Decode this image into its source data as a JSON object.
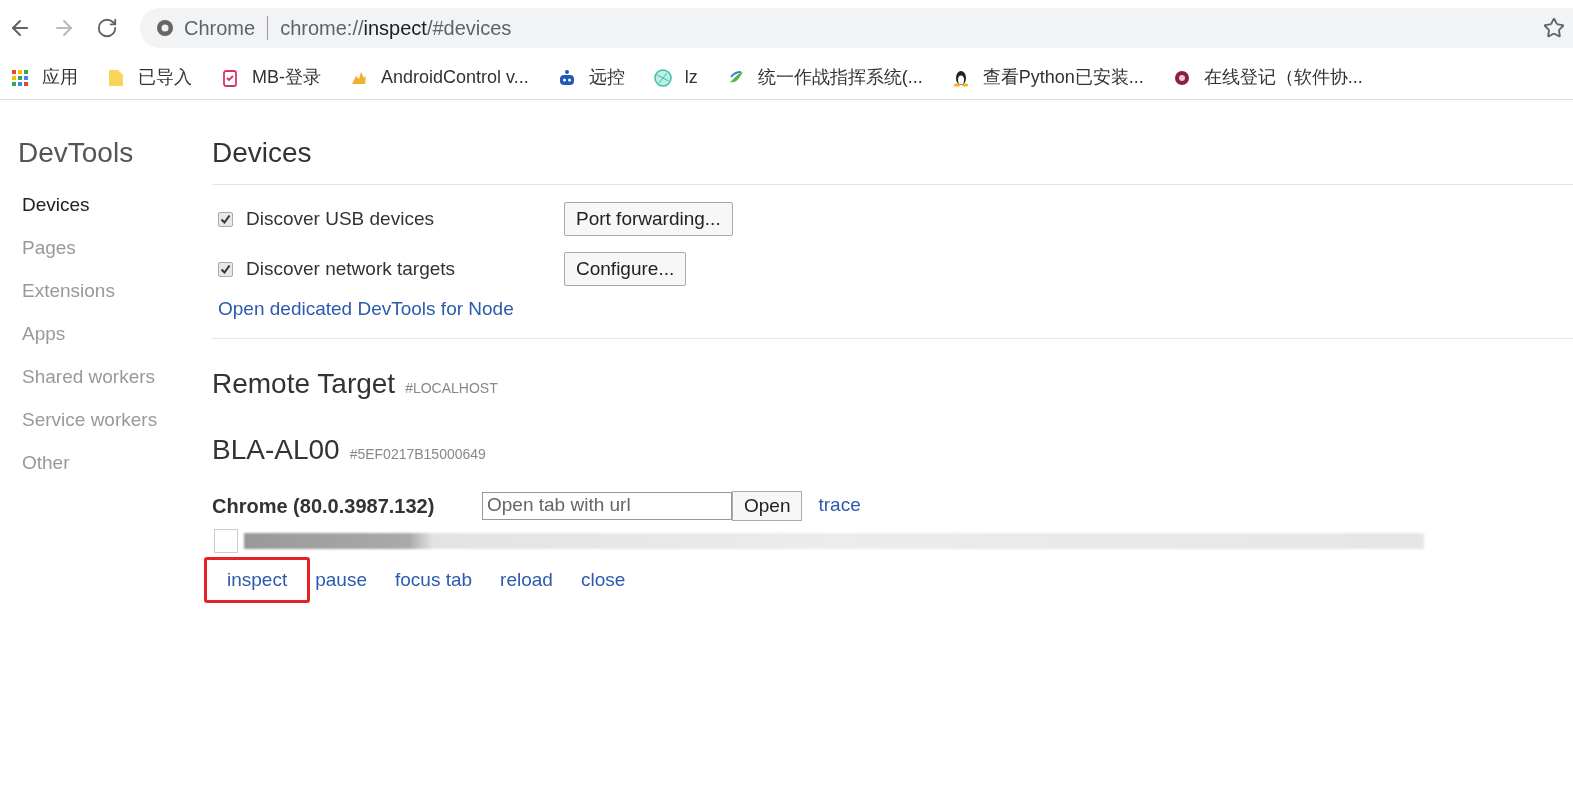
{
  "address_bar": {
    "site_label": "Chrome",
    "url_prefix": "chrome://",
    "url_host": "inspect",
    "url_path": "/#devices"
  },
  "bookmarks": [
    {
      "label": "应用"
    },
    {
      "label": "已导入"
    },
    {
      "label": "MB-登录"
    },
    {
      "label": "AndroidControl v..."
    },
    {
      "label": "远控"
    },
    {
      "label": "lz"
    },
    {
      "label": "统一作战指挥系统(..."
    },
    {
      "label": "查看Python已安装..."
    },
    {
      "label": "在线登记（软件协..."
    }
  ],
  "sidebar": {
    "title": "DevTools",
    "items": [
      {
        "label": "Devices",
        "selected": true
      },
      {
        "label": "Pages",
        "selected": false
      },
      {
        "label": "Extensions",
        "selected": false
      },
      {
        "label": "Apps",
        "selected": false
      },
      {
        "label": "Shared workers",
        "selected": false
      },
      {
        "label": "Service workers",
        "selected": false
      },
      {
        "label": "Other",
        "selected": false
      }
    ]
  },
  "devices": {
    "title": "Devices",
    "options": [
      {
        "label": "Discover USB devices",
        "checked": true,
        "button": "Port forwarding..."
      },
      {
        "label": "Discover network targets",
        "checked": true,
        "button": "Configure..."
      }
    ],
    "node_link": "Open dedicated DevTools for Node"
  },
  "remote_target": {
    "title": "Remote Target",
    "tag": "#LOCALHOST",
    "device": {
      "name": "BLA-AL00",
      "serial": "#5EF0217B15000649"
    },
    "browser": {
      "name": "Chrome (80.0.3987.132)",
      "url_placeholder": "Open tab with url",
      "open_button": "Open",
      "trace_link": "trace"
    },
    "actions": [
      {
        "label": "inspect",
        "highlighted": true
      },
      {
        "label": "pause",
        "highlighted": false
      },
      {
        "label": "focus tab",
        "highlighted": false
      },
      {
        "label": "reload",
        "highlighted": false
      },
      {
        "label": "close",
        "highlighted": false
      }
    ]
  }
}
